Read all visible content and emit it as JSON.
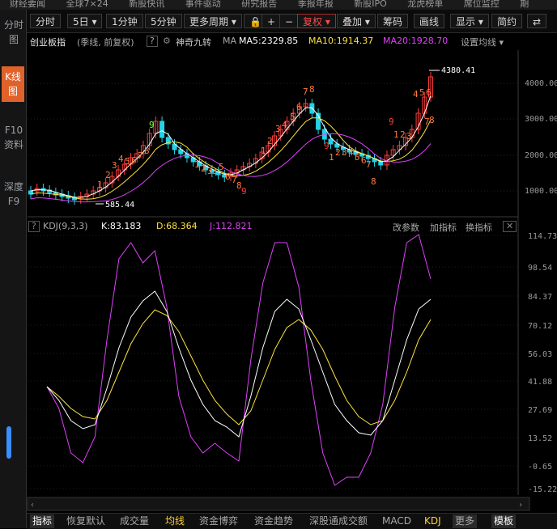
{
  "topnav": [
    "财经要闻",
    "全球7×24",
    "新股快讯",
    "事件驱动",
    "研究报告",
    "季报年报",
    "新股IPO",
    "龙虎榜单",
    "席位监控",
    "期"
  ],
  "sidebar": [
    {
      "label": "分时图",
      "active": false
    },
    {
      "label": "K线图",
      "active": true
    },
    {
      "label": "F10资料",
      "active": false
    },
    {
      "label": "深度F9",
      "active": false
    }
  ],
  "toolbar": {
    "buttons": [
      "分时",
      "5日 ▾",
      "1分钟",
      "5分钟",
      "更多周期 ▾",
      "🔒",
      "+",
      "−",
      "复权 ▾",
      "叠加 ▾",
      "筹码",
      "画线",
      "显示 ▾",
      "简约",
      "⇄"
    ]
  },
  "info": {
    "name": "创业板指",
    "mode": "(季线, 前复权)",
    "help": "?",
    "indicator": "神奇九转",
    "ma_label": "MA",
    "ma5": "MA5:2329.85",
    "ma10": "MA10:1914.37",
    "ma20": "MA20:1928.70",
    "settings": "设置均线 ▾"
  },
  "kdj": {
    "label": "KDJ(9,3,3)",
    "k": "K:83.183",
    "d": "D:68.364",
    "j": "J:112.821",
    "actions": [
      "改参数",
      "加指标",
      "换指标"
    ]
  },
  "price_axis": [
    "4000.00",
    "3000.00",
    "2000.00",
    "1000.00"
  ],
  "kdj_axis": [
    "114.73",
    "98.54",
    "84.37",
    "70.12",
    "56.03",
    "41.88",
    "27.69",
    "13.52",
    "-0.65",
    "-15.22"
  ],
  "annotations": {
    "high": "4380.41",
    "low": "585.44"
  },
  "nine_labels": [
    "1",
    "2",
    "3",
    "4",
    "5",
    "6",
    "7",
    "8",
    "9"
  ],
  "bottom_tabs": [
    {
      "label": "指标",
      "color": "#ffffff",
      "bg": "#2a2a2a"
    },
    {
      "label": "恢复默认",
      "color": "#a9a9a9"
    },
    {
      "label": "成交量",
      "color": "#a9a9a9"
    },
    {
      "label": "均线",
      "color": "#ffd23c"
    },
    {
      "label": "资金博弈",
      "color": "#a9a9a9"
    },
    {
      "label": "资金趋势",
      "color": "#a9a9a9"
    },
    {
      "label": "深股通成交额",
      "color": "#a9a9a9"
    },
    {
      "label": "MACD",
      "color": "#a9a9a9"
    },
    {
      "label": "KDJ",
      "color": "#ffd23c"
    },
    {
      "label": "更多",
      "color": "#a9a9a9",
      "bg": "#2a2a2a"
    },
    {
      "label": "模板",
      "color": "#ffffff",
      "bg": "#2a2a2a"
    }
  ],
  "colors": {
    "up": "#ff3b3b",
    "down": "#22d3e6",
    "ma5": "#ffffff",
    "ma10": "#ffe23c",
    "ma20": "#e040fb",
    "j": "#e040fb"
  }
}
